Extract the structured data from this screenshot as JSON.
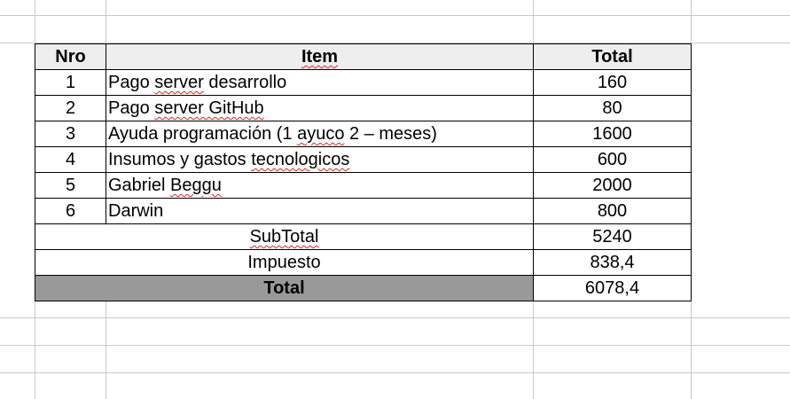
{
  "table": {
    "headers": {
      "nro": "Nro",
      "item": "Item",
      "total": "Total"
    },
    "rows": [
      {
        "nro": "1",
        "item_pre": "Pago ",
        "item_mark": "server",
        "item_post": " desarrollo",
        "total": "160"
      },
      {
        "nro": "2",
        "item_pre": "Pago ",
        "item_mark": "server GitHub",
        "item_post": "",
        "total": "80"
      },
      {
        "nro": "3",
        "item_pre": "Ayuda programación (1 ",
        "item_mark": "ayuco",
        "item_post": " 2 – meses)",
        "total": "1600"
      },
      {
        "nro": "4",
        "item_pre": "Insumos y gastos ",
        "item_mark": "tecnologicos",
        "item_post": "",
        "total": "600"
      },
      {
        "nro": "5",
        "item_pre": "Gabriel ",
        "item_mark": "Beggu",
        "item_post": "",
        "total": "2000"
      },
      {
        "nro": "6",
        "item_pre": "Darwin",
        "item_mark": "",
        "item_post": "",
        "total": "800"
      }
    ],
    "subtotal": {
      "label": "SubTotal",
      "value": "5240"
    },
    "tax": {
      "label": "Impuesto",
      "value": "838,4"
    },
    "grand_total": {
      "label": "Total",
      "value": "6078,4"
    }
  },
  "colors": {
    "header_bg": "#eeeeee",
    "grand_total_bg": "#999999",
    "spellcheck_underline": "#e0241b",
    "grid": "#c8c8c8"
  }
}
